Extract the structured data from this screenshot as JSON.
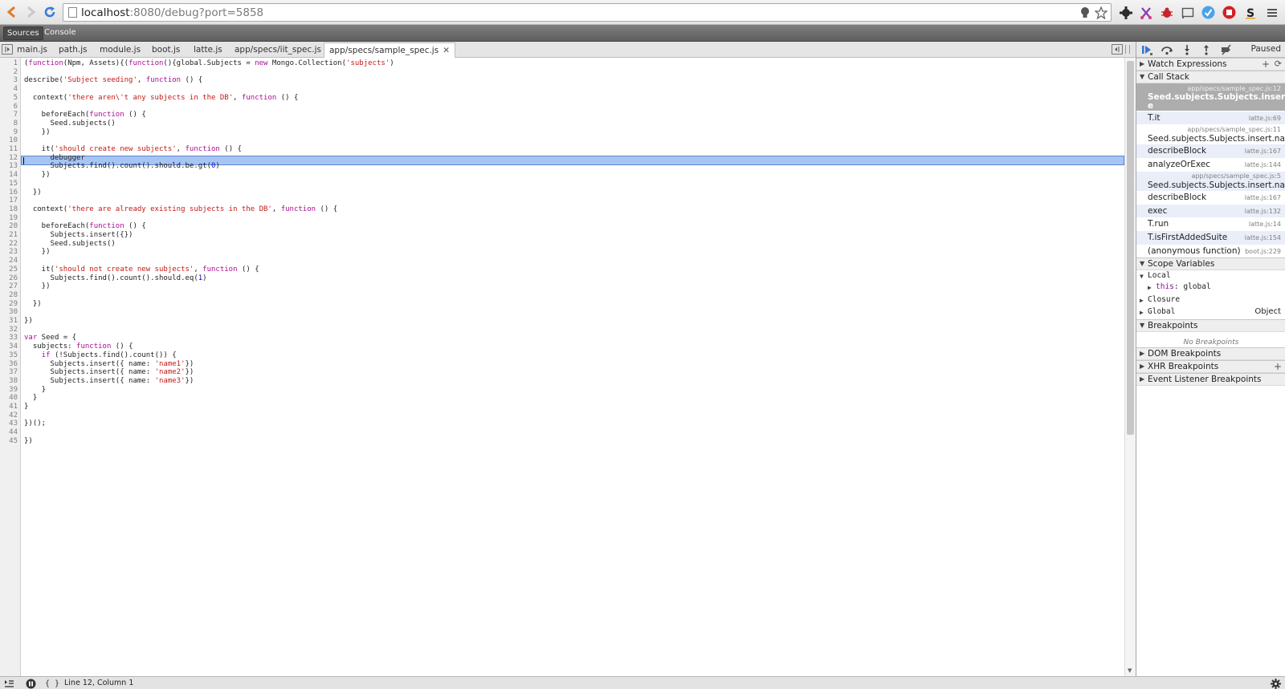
{
  "browser": {
    "url_host": "localhost",
    "url_rest": ":8080/debug?port=5858"
  },
  "devtools": {
    "tabs": [
      "Sources",
      "Console"
    ],
    "active_tab": "Sources"
  },
  "file_tabs": [
    {
      "label": "main.js"
    },
    {
      "label": "path.js"
    },
    {
      "label": "module.js"
    },
    {
      "label": "boot.js"
    },
    {
      "label": "latte.js"
    },
    {
      "label": "app/specs/iit_spec.js"
    },
    {
      "label": "app/specs/sample_spec.js",
      "active": true
    }
  ],
  "editor": {
    "current_line": 12,
    "lines": [
      "(function(Npm, Assets){(function(){global.Subjects = new Mongo.Collection('subjects')",
      "",
      "describe('Subject seeding', function () {",
      "",
      "  context('there aren\\'t any subjects in the DB', function () {",
      "",
      "    beforeEach(function () {",
      "      Seed.subjects()",
      "    })",
      "",
      "    it('should create new subjects', function () {",
      "      debugger",
      "      Subjects.find().count().should.be.gt(0)",
      "    })",
      "",
      "  })",
      "",
      "  context('there are already existing subjects in the DB', function () {",
      "",
      "    beforeEach(function () {",
      "      Subjects.insert({})",
      "      Seed.subjects()",
      "    })",
      "",
      "    it('should not create new subjects', function () {",
      "      Subjects.find().count().should.eq(1)",
      "    })",
      "",
      "  })",
      "",
      "})",
      "",
      "var Seed = {",
      "  subjects: function () {",
      "    if (!Subjects.find().count()) {",
      "      Subjects.insert({ name: 'name1'})",
      "      Subjects.insert({ name: 'name2'})",
      "      Subjects.insert({ name: 'name3'})",
      "    }",
      "  }",
      "}",
      "",
      "})();",
      "",
      "})"
    ]
  },
  "sidebar": {
    "status": "Paused",
    "sections": {
      "watch": "Watch Expressions",
      "call_stack": "Call Stack",
      "scope": "Scope Variables",
      "breakpoints": "Breakpoints",
      "dom_breakpoints": "DOM Breakpoints",
      "xhr_breakpoints": "XHR Breakpoints",
      "event_breakpoints": "Event Listener Breakpoints"
    },
    "call_stack": [
      {
        "name": "Seed.subjects.Subjects.insert.name",
        "name2": "e",
        "location": "app/specs/sample_spec.js:12",
        "selected": true
      },
      {
        "name": "T.it",
        "location": "latte.js:69"
      },
      {
        "name": "Seed.subjects.Subjects.insert.name",
        "location": "app/specs/sample_spec.js:11"
      },
      {
        "name": "describeBlock",
        "location": "latte.js:167"
      },
      {
        "name": "analyzeOrExec",
        "location": "latte.js:144"
      },
      {
        "name": "Seed.subjects.Subjects.insert.name",
        "location": "app/specs/sample_spec.js:5"
      },
      {
        "name": "describeBlock",
        "location": "latte.js:167"
      },
      {
        "name": "exec",
        "location": "latte.js:132"
      },
      {
        "name": "T.run",
        "location": "latte.js:14"
      },
      {
        "name": "T.isFirstAddedSuite",
        "location": "latte.js:154"
      },
      {
        "name": "(anonymous function)",
        "location": "boot.js:229"
      }
    ],
    "scope": {
      "local": "Local",
      "this_key": "this",
      "this_value": "global",
      "closure": "Closure",
      "global": "Global",
      "global_value": "Object"
    },
    "no_breakpoints": "No Breakpoints"
  },
  "status_bar": {
    "position": "Line 12, Column 1",
    "pretty_print": "{ }"
  }
}
